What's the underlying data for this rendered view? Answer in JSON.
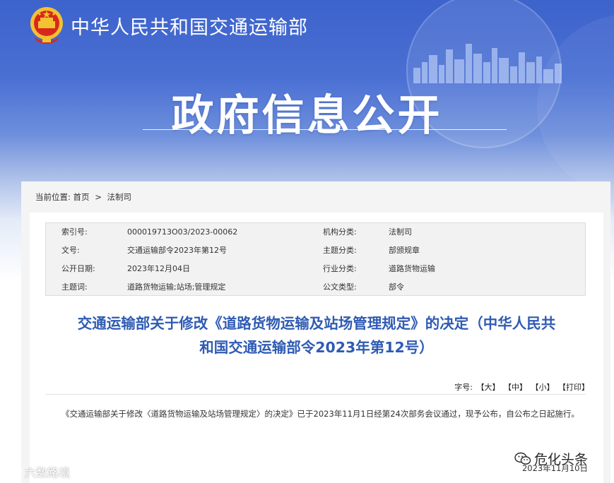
{
  "header": {
    "ministry_name": "中华人民共和国交通运输部",
    "section_title": "政府信息公开"
  },
  "breadcrumb": {
    "prefix": "当前位置:",
    "home": "首页",
    "separator": ">",
    "current": "法制司"
  },
  "meta": {
    "rows": [
      {
        "k1": "索引号:",
        "v1": "000019713O03/2023-00062",
        "k2": "机构分类:",
        "v2": "法制司"
      },
      {
        "k1": "文号:",
        "v1": "交通运输部令2023年第12号",
        "k2": "主题分类:",
        "v2": "部颁规章"
      },
      {
        "k1": "公开日期:",
        "v1": "2023年12月04日",
        "k2": "行业分类:",
        "v2": "道路货物运输"
      },
      {
        "k1": "主题词:",
        "v1": "道路货物运输;站场;管理规定",
        "k2": "公文类型:",
        "v2": "部令"
      }
    ]
  },
  "document": {
    "title_line1": "交通运输部关于修改《道路货物运输及站场管理规定》的决定（中华人民共",
    "title_line2": "和国交通运输部令2023年第12号）",
    "body": "《交通运输部关于修改〈道路货物运输及站场管理规定〉的决定》已于2023年11月1日经第24次部务会议通过，现予公布，自公布之日起施行。",
    "date": "2023年11月10日"
  },
  "tools": {
    "label": "字号:",
    "large": "【大】",
    "medium": "【中】",
    "small": "【小】",
    "print": "【打印】"
  },
  "watermarks": {
    "left": "六数路境",
    "right": "危化头条"
  },
  "colors": {
    "banner_blue": "#3d63cc",
    "title_blue": "#2f5bb3"
  }
}
